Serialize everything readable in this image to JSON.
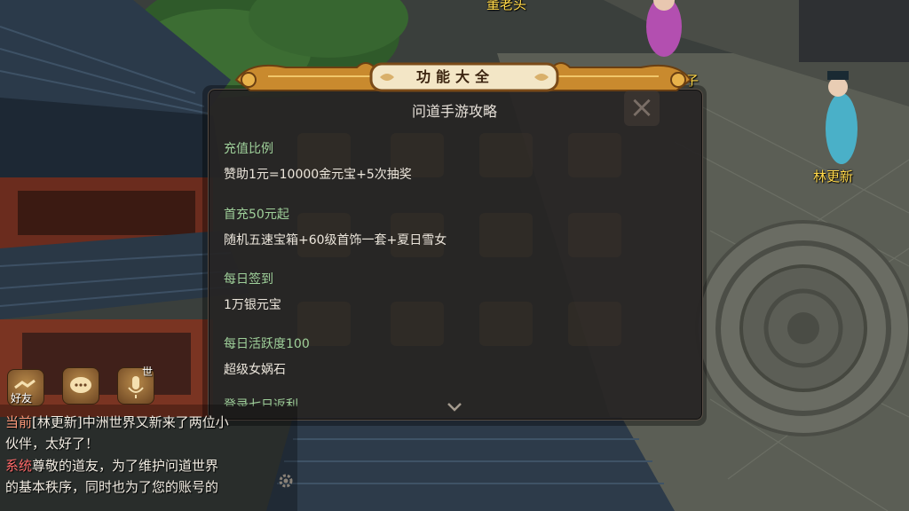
{
  "scene": {
    "npc_top": "董老头",
    "npc_right": "林更新",
    "npc_top_right_partial": "子"
  },
  "dialog": {
    "banner_title": "功能大全",
    "title": "问道手游攻略",
    "sections": [
      {
        "heading": "充值比例",
        "body": "赞助1元=10000金元宝+5次抽奖"
      },
      {
        "heading": "首充50元起",
        "body": "随机五速宝箱+60级首饰一套+夏日雪女"
      },
      {
        "heading": "每日签到",
        "body": "1万银元宝"
      },
      {
        "heading": "每日活跃度100",
        "body": "超级女娲石"
      },
      {
        "heading": "登录七日返利",
        "body": ""
      }
    ],
    "close_icon": "close-x-icon",
    "scroll_icon": "chevron-down-icon"
  },
  "chat": {
    "friend_label": "好友",
    "voice_world_label": "世",
    "lines": [
      {
        "tag": "当前",
        "text": "[林更新]中洲世界又新来了两位小"
      },
      {
        "tag": "",
        "text": "伙伴，太好了！"
      },
      {
        "tag": "系统",
        "text": "尊敬的道友，为了维护问道世界"
      },
      {
        "tag": "",
        "text": "的基本秩序，同时也为了您的账号的"
      }
    ],
    "icons": [
      "friends-handshake-icon",
      "chat-bubble-icon",
      "microphone-icon",
      "settings-gear-icon"
    ]
  },
  "colors": {
    "section_heading": "#9fd09a",
    "npc_name": "#ffd84a",
    "banner_gold": "#e8b24a"
  }
}
